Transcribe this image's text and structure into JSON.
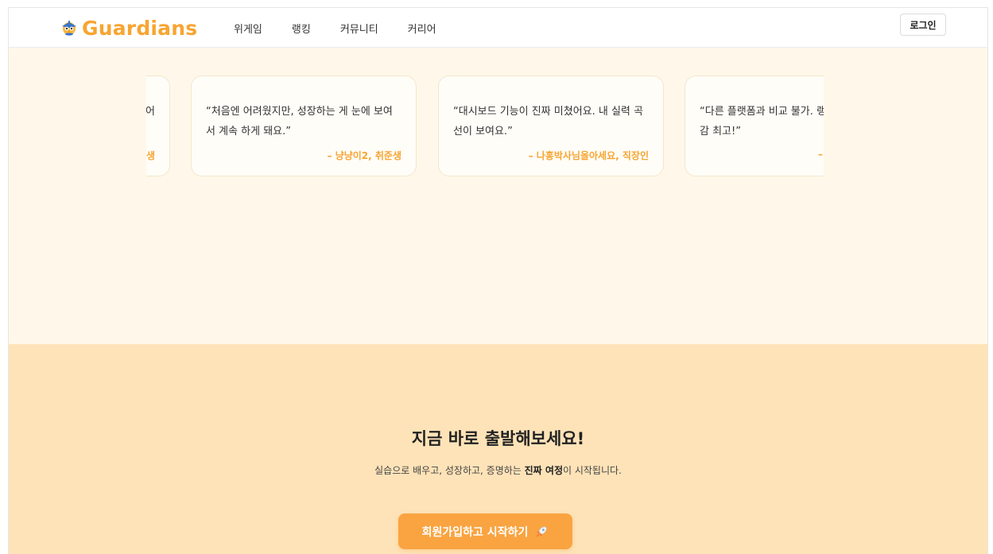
{
  "brand": {
    "name": "Guardians",
    "icon": "owl-logo-icon",
    "color": "#f7a531"
  },
  "nav": {
    "items": [
      {
        "label": "위게임"
      },
      {
        "label": "랭킹"
      },
      {
        "label": "커뮤니티"
      },
      {
        "label": "커리어"
      }
    ],
    "login_label": "로그인"
  },
  "testimonials": [
    {
      "quote": "어",
      "author": "생"
    },
    {
      "quote": "“처음엔 어려웠지만, 성장하는 게 눈에 보여서 계속 하게 돼요.”",
      "author": "– 냥냥이2, 취준생"
    },
    {
      "quote": "“대시보드 기능이 진짜 미쳤어요. 내 실력 곡선이 보여요.”",
      "author": "– 나홍박사님올아세요, 직장인"
    },
    {
      "quote": "“다른 플랫폼과 비교 불가. 랭킹 감 최고!”",
      "author": "–"
    }
  ],
  "cta": {
    "title": "지금 바로 출발해보세요!",
    "subtitle_pre": "실습으로 배우고, 성장하고, 증명하는 ",
    "subtitle_bold": "진짜 여정",
    "subtitle_post": "이 시작됩니다.",
    "button_label": "회원가입하고 시작하기",
    "button_icon": "rocket-icon",
    "button_color": "#f9a441"
  },
  "colors": {
    "page_bg": "#fff8ea",
    "cta_bg": "#ffe3b8",
    "accent": "#f7a531"
  }
}
